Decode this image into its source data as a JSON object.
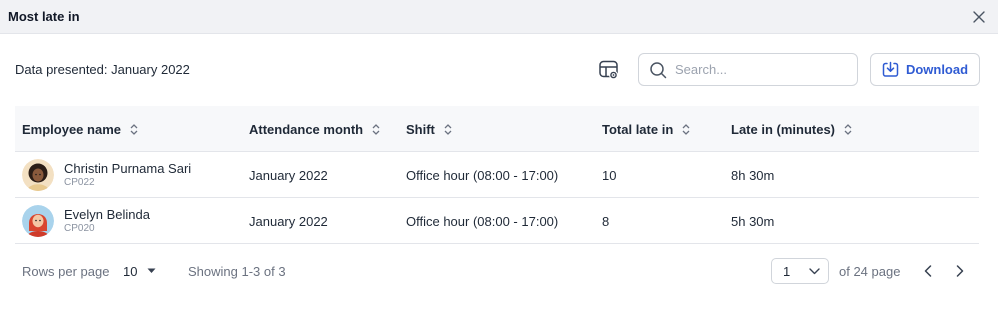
{
  "modal": {
    "title": "Most late in"
  },
  "toolbar": {
    "data_presented": "Data presented: January 2022",
    "search_placeholder": "Search...",
    "download_label": "Download"
  },
  "table": {
    "columns": [
      "Employee name",
      "Attendance month",
      "Shift",
      "Total late in",
      "Late in (minutes)"
    ],
    "rows": [
      {
        "name": "Christin Purnama Sari",
        "id": "CP022",
        "month": "January 2022",
        "shift": "Office hour (08:00 - 17:00)",
        "total": "10",
        "minutes": "8h 30m"
      },
      {
        "name": "Evelyn Belinda",
        "id": "CP020",
        "month": "January 2022",
        "shift": "Office hour (08:00 - 17:00)",
        "total": "8",
        "minutes": "5h 30m"
      }
    ]
  },
  "footer": {
    "rows_per_page_label": "Rows per page",
    "rows_per_page_value": "10",
    "showing": "Showing 1-3 of 3",
    "page_value": "1",
    "of_pages": "of 24 page"
  },
  "icons": {
    "close": "close-icon",
    "settings": "table-settings-icon",
    "search": "search-icon",
    "download": "download-icon",
    "sort": "sort-icon",
    "chevron_down": "chevron-down-icon",
    "prev": "chevron-left-icon",
    "next": "chevron-right-icon"
  },
  "colors": {
    "accent": "#2f5bd3",
    "header_bg": "#f1f2f5",
    "table_header_bg": "#f7f8fa"
  }
}
